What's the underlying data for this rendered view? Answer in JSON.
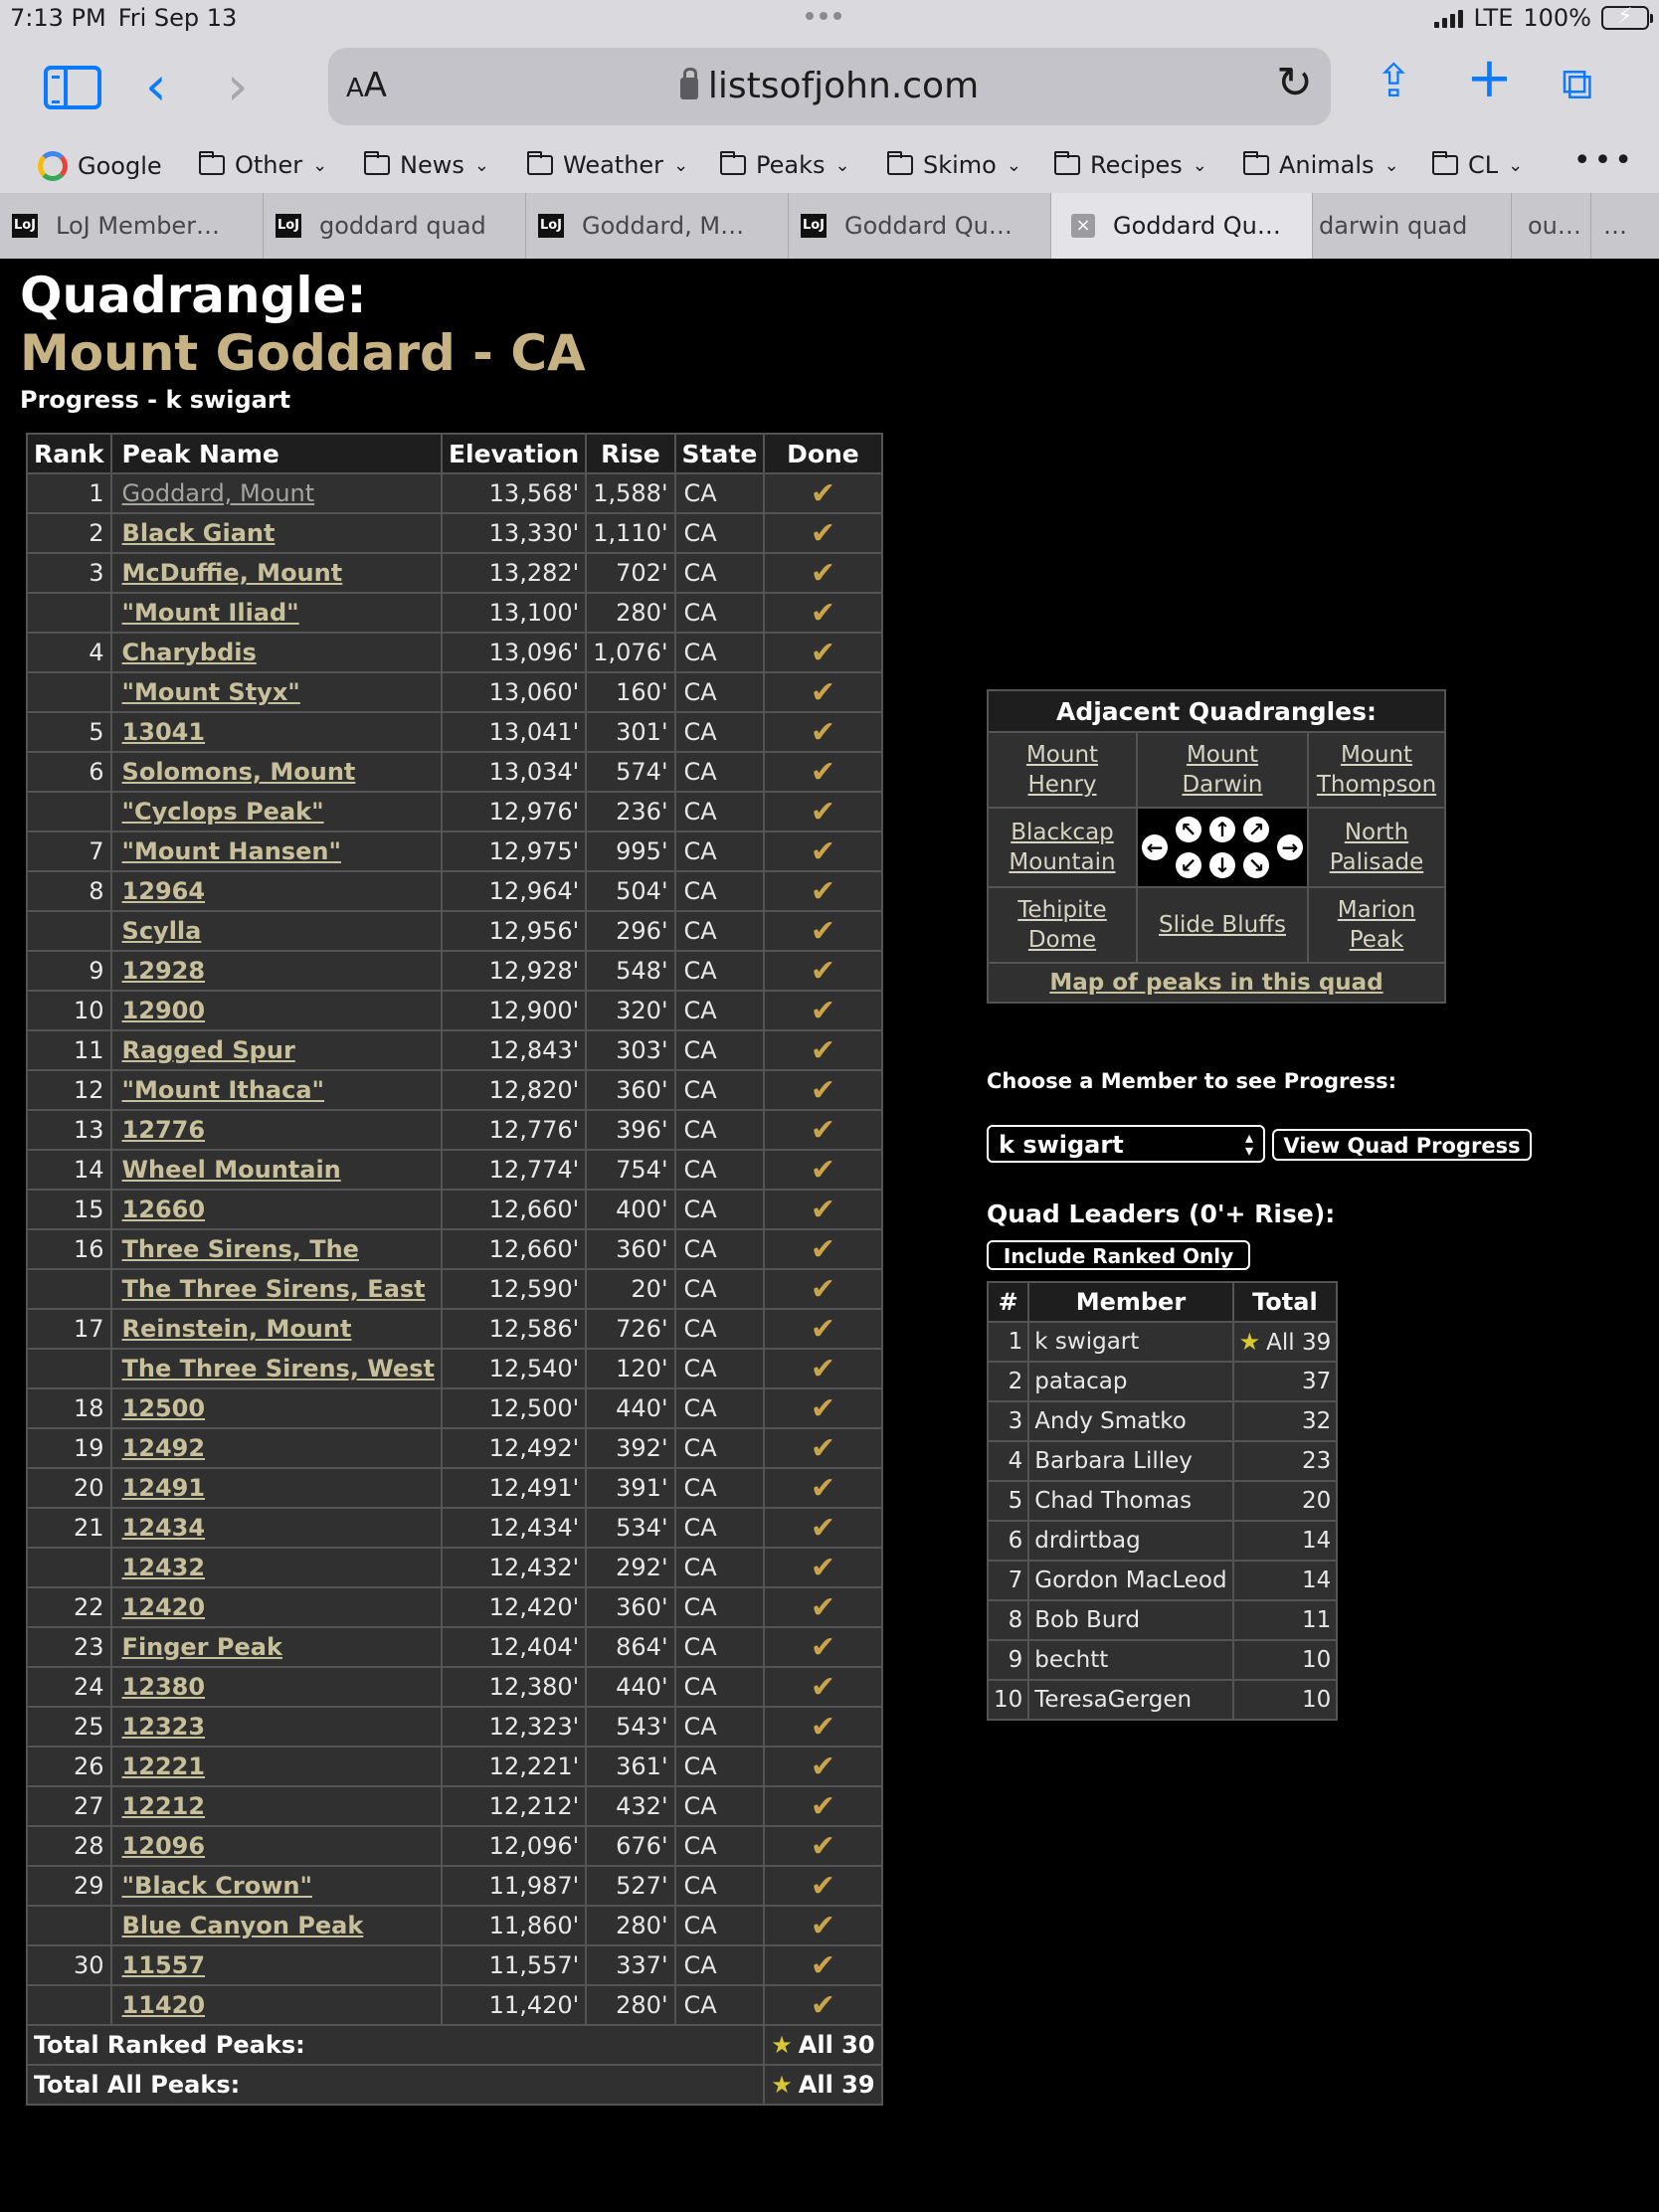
{
  "status": {
    "time": "7:13 PM",
    "date": "Fri Sep 13",
    "network": "LTE",
    "battery": "100%"
  },
  "browser": {
    "url": "listsofjohn.com",
    "aa_label": "AA",
    "bookmarks": [
      "Google",
      "Other",
      "News",
      "Weather",
      "Peaks",
      "Skimo",
      "Recipes",
      "Animals",
      "CL"
    ],
    "tabs": [
      {
        "label": "LoJ Member…",
        "favicon": "LoJ"
      },
      {
        "label": "goddard quad",
        "favicon": "LoJ"
      },
      {
        "label": "Goddard, M…",
        "favicon": "LoJ"
      },
      {
        "label": "Goddard Qu…",
        "favicon": "LoJ"
      },
      {
        "label": "Goddard Qu…",
        "active": true
      },
      {
        "label": "darwin quad"
      },
      {
        "label": "ou…"
      },
      {
        "label": "…"
      }
    ]
  },
  "page": {
    "title_line1": "Quadrangle:",
    "title_line2": "Mount Goddard - CA",
    "progress_title": "Progress - k swigart",
    "peaks_headers": [
      "Rank",
      "Peak Name",
      "Elevation",
      "Rise",
      "State",
      "Done"
    ],
    "peaks": [
      {
        "rank": "1",
        "name": "Goddard, Mount",
        "elev": "13,568'",
        "rise": "1,588'",
        "state": "CA"
      },
      {
        "rank": "2",
        "name": "Black Giant",
        "elev": "13,330'",
        "rise": "1,110'",
        "state": "CA"
      },
      {
        "rank": "3",
        "name": "McDuffie, Mount",
        "elev": "13,282'",
        "rise": "702'",
        "state": "CA"
      },
      {
        "rank": "",
        "name": "\"Mount Iliad\"",
        "elev": "13,100'",
        "rise": "280'",
        "state": "CA"
      },
      {
        "rank": "4",
        "name": "Charybdis",
        "elev": "13,096'",
        "rise": "1,076'",
        "state": "CA"
      },
      {
        "rank": "",
        "name": "\"Mount Styx\"",
        "elev": "13,060'",
        "rise": "160'",
        "state": "CA"
      },
      {
        "rank": "5",
        "name": "13041",
        "elev": "13,041'",
        "rise": "301'",
        "state": "CA"
      },
      {
        "rank": "6",
        "name": "Solomons, Mount",
        "elev": "13,034'",
        "rise": "574'",
        "state": "CA"
      },
      {
        "rank": "",
        "name": "\"Cyclops Peak\"",
        "elev": "12,976'",
        "rise": "236'",
        "state": "CA"
      },
      {
        "rank": "7",
        "name": "\"Mount Hansen\"",
        "elev": "12,975'",
        "rise": "995'",
        "state": "CA"
      },
      {
        "rank": "8",
        "name": "12964",
        "elev": "12,964'",
        "rise": "504'",
        "state": "CA"
      },
      {
        "rank": "",
        "name": "Scylla",
        "elev": "12,956'",
        "rise": "296'",
        "state": "CA"
      },
      {
        "rank": "9",
        "name": "12928",
        "elev": "12,928'",
        "rise": "548'",
        "state": "CA"
      },
      {
        "rank": "10",
        "name": "12900",
        "elev": "12,900'",
        "rise": "320'",
        "state": "CA"
      },
      {
        "rank": "11",
        "name": "Ragged Spur",
        "elev": "12,843'",
        "rise": "303'",
        "state": "CA"
      },
      {
        "rank": "12",
        "name": "\"Mount Ithaca\"",
        "elev": "12,820'",
        "rise": "360'",
        "state": "CA"
      },
      {
        "rank": "13",
        "name": "12776",
        "elev": "12,776'",
        "rise": "396'",
        "state": "CA"
      },
      {
        "rank": "14",
        "name": "Wheel Mountain",
        "elev": "12,774'",
        "rise": "754'",
        "state": "CA"
      },
      {
        "rank": "15",
        "name": "12660",
        "elev": "12,660'",
        "rise": "400'",
        "state": "CA"
      },
      {
        "rank": "16",
        "name": "Three Sirens, The",
        "elev": "12,660'",
        "rise": "360'",
        "state": "CA"
      },
      {
        "rank": "",
        "name": "The Three Sirens, East",
        "elev": "12,590'",
        "rise": "20'",
        "state": "CA"
      },
      {
        "rank": "17",
        "name": "Reinstein, Mount",
        "elev": "12,586'",
        "rise": "726'",
        "state": "CA"
      },
      {
        "rank": "",
        "name": "The Three Sirens, West",
        "elev": "12,540'",
        "rise": "120'",
        "state": "CA"
      },
      {
        "rank": "18",
        "name": "12500",
        "elev": "12,500'",
        "rise": "440'",
        "state": "CA"
      },
      {
        "rank": "19",
        "name": "12492",
        "elev": "12,492'",
        "rise": "392'",
        "state": "CA"
      },
      {
        "rank": "20",
        "name": "12491",
        "elev": "12,491'",
        "rise": "391'",
        "state": "CA"
      },
      {
        "rank": "21",
        "name": "12434",
        "elev": "12,434'",
        "rise": "534'",
        "state": "CA"
      },
      {
        "rank": "",
        "name": "12432",
        "elev": "12,432'",
        "rise": "292'",
        "state": "CA"
      },
      {
        "rank": "22",
        "name": "12420",
        "elev": "12,420'",
        "rise": "360'",
        "state": "CA"
      },
      {
        "rank": "23",
        "name": "Finger Peak",
        "elev": "12,404'",
        "rise": "864'",
        "state": "CA"
      },
      {
        "rank": "24",
        "name": "12380",
        "elev": "12,380'",
        "rise": "440'",
        "state": "CA"
      },
      {
        "rank": "25",
        "name": "12323",
        "elev": "12,323'",
        "rise": "543'",
        "state": "CA"
      },
      {
        "rank": "26",
        "name": "12221",
        "elev": "12,221'",
        "rise": "361'",
        "state": "CA"
      },
      {
        "rank": "27",
        "name": "12212",
        "elev": "12,212'",
        "rise": "432'",
        "state": "CA"
      },
      {
        "rank": "28",
        "name": "12096",
        "elev": "12,096'",
        "rise": "676'",
        "state": "CA"
      },
      {
        "rank": "29",
        "name": "\"Black Crown\"",
        "elev": "11,987'",
        "rise": "527'",
        "state": "CA"
      },
      {
        "rank": "",
        "name": "Blue Canyon Peak",
        "elev": "11,860'",
        "rise": "280'",
        "state": "CA"
      },
      {
        "rank": "30",
        "name": "11557",
        "elev": "11,557'",
        "rise": "337'",
        "state": "CA"
      },
      {
        "rank": "",
        "name": "11420",
        "elev": "11,420'",
        "rise": "280'",
        "state": "CA"
      }
    ],
    "done_mark": "✔",
    "totals": [
      {
        "label": "Total Ranked Peaks:",
        "value": "All 30"
      },
      {
        "label": "Total All Peaks:",
        "value": "All 39"
      }
    ],
    "adjacent": {
      "title": "Adjacent Quadrangles:",
      "nw": "Mount Henry",
      "n": "Mount Darwin",
      "ne": "Mount Thompson",
      "w": "Blackcap Mountain",
      "e": "North Palisade",
      "sw": "Tehipite Dome",
      "s": "Slide Bluffs",
      "se": "Marion Peak",
      "map_link": "Map of peaks in this quad"
    },
    "choose_member": "Choose a Member to see Progress:",
    "member_select": "k swigart",
    "view_button": "View Quad Progress",
    "leaders_title": "Quad Leaders (0'+ Rise):",
    "ranked_button": "Include Ranked Only",
    "leaders_headers": [
      "#",
      "Member",
      "Total"
    ],
    "leaders": [
      {
        "n": "1",
        "member": "k swigart",
        "total": "All 39",
        "star": true
      },
      {
        "n": "2",
        "member": "patacap",
        "total": "37"
      },
      {
        "n": "3",
        "member": "Andy Smatko",
        "total": "32"
      },
      {
        "n": "4",
        "member": "Barbara Lilley",
        "total": "23"
      },
      {
        "n": "5",
        "member": "Chad Thomas",
        "total": "20"
      },
      {
        "n": "6",
        "member": "drdirtbag",
        "total": "14"
      },
      {
        "n": "7",
        "member": "Gordon MacLeod",
        "total": "14"
      },
      {
        "n": "8",
        "member": "Bob Burd",
        "total": "11"
      },
      {
        "n": "9",
        "member": "bechtt",
        "total": "10"
      },
      {
        "n": "10",
        "member": "TeresaGergen",
        "total": "10"
      }
    ],
    "colors": {
      "title_gold": "#c7b283",
      "link": "#c7c09a",
      "check": "#c9a34c",
      "star": "#d8c633",
      "safari_blue": "#0a7aff"
    }
  }
}
